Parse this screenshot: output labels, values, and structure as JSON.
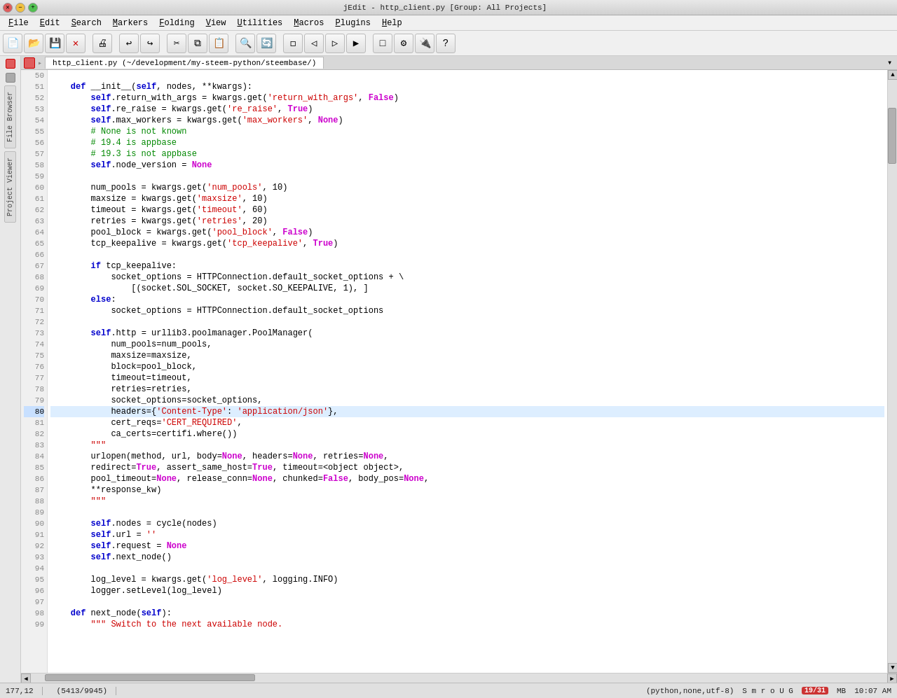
{
  "window": {
    "title": "jEdit - http_client.py [Group: All Projects]"
  },
  "menubar": {
    "items": [
      "File",
      "Edit",
      "Search",
      "Markers",
      "Folding",
      "View",
      "Utilities",
      "Macros",
      "Plugins",
      "Help"
    ]
  },
  "toolbar": {
    "buttons": [
      "new",
      "open",
      "save",
      "close",
      "print",
      "undo",
      "redo",
      "cut",
      "copy",
      "paste",
      "find",
      "replace",
      "expand",
      "shrink",
      "prev",
      "next",
      "shrink2",
      "settings",
      "plugin",
      "help"
    ]
  },
  "tabs": [
    {
      "label": "http_client.py (~/development/my-steem-python/steembase/)",
      "active": true
    }
  ],
  "editor": {
    "lines": [
      {
        "num": 50,
        "content": "",
        "highlight": false
      },
      {
        "num": 51,
        "content": "    def __init__(self, nodes, **kwargs):",
        "highlight": false
      },
      {
        "num": 52,
        "content": "        self.return_with_args = kwargs.get('return_with_args', False)",
        "highlight": false
      },
      {
        "num": 53,
        "content": "        self.re_raise = kwargs.get('re_raise', True)",
        "highlight": false
      },
      {
        "num": 54,
        "content": "        self.max_workers = kwargs.get('max_workers', None)",
        "highlight": false
      },
      {
        "num": 55,
        "content": "        # None is not known",
        "highlight": false
      },
      {
        "num": 56,
        "content": "        # 19.4 is appbase",
        "highlight": false
      },
      {
        "num": 57,
        "content": "        # 19.3 is not appbase",
        "highlight": false
      },
      {
        "num": 58,
        "content": "        self.node_version = None",
        "highlight": false
      },
      {
        "num": 59,
        "content": "",
        "highlight": false
      },
      {
        "num": 60,
        "content": "        num_pools = kwargs.get('num_pools', 10)",
        "highlight": false
      },
      {
        "num": 61,
        "content": "        maxsize = kwargs.get('maxsize', 10)",
        "highlight": false
      },
      {
        "num": 62,
        "content": "        timeout = kwargs.get('timeout', 60)",
        "highlight": false
      },
      {
        "num": 63,
        "content": "        retries = kwargs.get('retries', 20)",
        "highlight": false
      },
      {
        "num": 64,
        "content": "        pool_block = kwargs.get('pool_block', False)",
        "highlight": false
      },
      {
        "num": 65,
        "content": "        tcp_keepalive = kwargs.get('tcp_keepalive', True)",
        "highlight": false
      },
      {
        "num": 66,
        "content": "",
        "highlight": false
      },
      {
        "num": 67,
        "content": "        if tcp_keepalive:",
        "highlight": false
      },
      {
        "num": 68,
        "content": "            socket_options = HTTPConnection.default_socket_options + \\",
        "highlight": false
      },
      {
        "num": 69,
        "content": "                [(socket.SOL_SOCKET, socket.SO_KEEPALIVE, 1), ]",
        "highlight": false
      },
      {
        "num": 70,
        "content": "        else:",
        "highlight": false
      },
      {
        "num": 71,
        "content": "            socket_options = HTTPConnection.default_socket_options",
        "highlight": false
      },
      {
        "num": 72,
        "content": "",
        "highlight": false
      },
      {
        "num": 73,
        "content": "        self.http = urllib3.poolmanager.PoolManager(",
        "highlight": false
      },
      {
        "num": 74,
        "content": "            num_pools=num_pools,",
        "highlight": false
      },
      {
        "num": 75,
        "content": "            maxsize=maxsize,",
        "highlight": false
      },
      {
        "num": 76,
        "content": "            block=pool_block,",
        "highlight": false
      },
      {
        "num": 77,
        "content": "            timeout=timeout,",
        "highlight": false
      },
      {
        "num": 78,
        "content": "            retries=retries,",
        "highlight": false
      },
      {
        "num": 79,
        "content": "            socket_options=socket_options,",
        "highlight": false
      },
      {
        "num": 80,
        "content": "            headers={'Content-Type': 'application/json'},",
        "highlight": true
      },
      {
        "num": 81,
        "content": "            cert_reqs='CERT_REQUIRED',",
        "highlight": false
      },
      {
        "num": 82,
        "content": "            ca_certs=certifi.where())",
        "highlight": false
      },
      {
        "num": 83,
        "content": "        \"\"\"",
        "highlight": false
      },
      {
        "num": 84,
        "content": "        urlopen(method, url, body=None, headers=None, retries=None,",
        "highlight": false
      },
      {
        "num": 85,
        "content": "        redirect=True, assert_same_host=True, timeout=<object object>,",
        "highlight": false
      },
      {
        "num": 86,
        "content": "        pool_timeout=None, release_conn=None, chunked=False, body_pos=None,",
        "highlight": false
      },
      {
        "num": 87,
        "content": "        **response_kw)",
        "highlight": false
      },
      {
        "num": 88,
        "content": "        \"\"\"",
        "highlight": false
      },
      {
        "num": 89,
        "content": "",
        "highlight": false
      },
      {
        "num": 90,
        "content": "        self.nodes = cycle(nodes)",
        "highlight": false
      },
      {
        "num": 91,
        "content": "        self.url = ''",
        "highlight": false
      },
      {
        "num": 92,
        "content": "        self.request = None",
        "highlight": false
      },
      {
        "num": 93,
        "content": "        self.next_node()",
        "highlight": false
      },
      {
        "num": 94,
        "content": "",
        "highlight": false
      },
      {
        "num": 95,
        "content": "        log_level = kwargs.get('log_level', logging.INFO)",
        "highlight": false
      },
      {
        "num": 96,
        "content": "        logger.setLevel(log_level)",
        "highlight": false
      },
      {
        "num": 97,
        "content": "",
        "highlight": false
      },
      {
        "num": 98,
        "content": "    def next_node(self):",
        "highlight": false
      },
      {
        "num": 99,
        "content": "        \"\"\" Switch to the next available node.",
        "highlight": false
      }
    ]
  },
  "statusbar": {
    "position": "177,12",
    "char_info": "(5413/9945)",
    "encoding": "(python,none,utf-8)",
    "modes": "S m r o U G",
    "memory_badge": "19/31",
    "memory_unit": "MB",
    "time": "10:07 AM"
  },
  "sidepanels": [
    "File Browser",
    "Project Viewer"
  ]
}
